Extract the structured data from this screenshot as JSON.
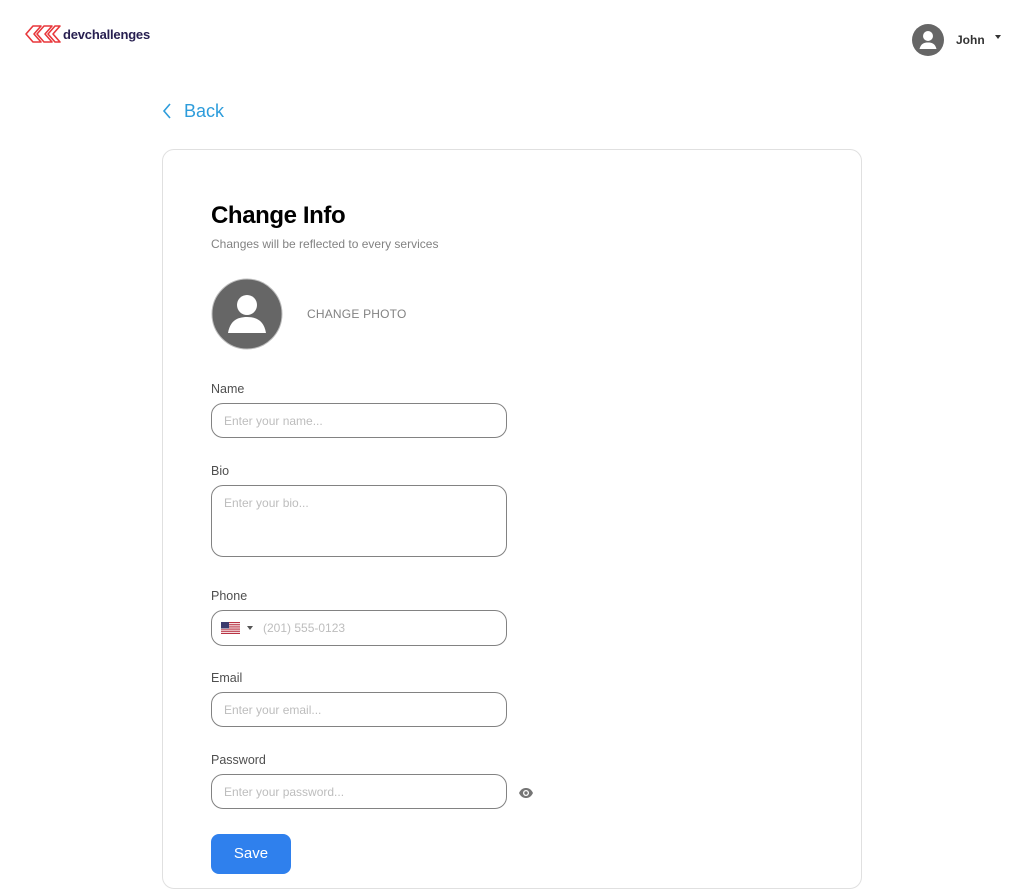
{
  "header": {
    "logo_text": "devchallenges",
    "user_name": "John",
    "brand_color": "#E8373B"
  },
  "nav": {
    "back_label": "Back"
  },
  "form": {
    "title": "Change Info",
    "subtitle": "Changes will be reflected to every services",
    "change_photo_label": "CHANGE PHOTO",
    "name": {
      "label": "Name",
      "placeholder": "Enter your name...",
      "value": ""
    },
    "bio": {
      "label": "Bio",
      "placeholder": "Enter your bio...",
      "value": ""
    },
    "phone": {
      "label": "Phone",
      "placeholder": "(201) 555-0123",
      "country": "US",
      "value": ""
    },
    "email": {
      "label": "Email",
      "placeholder": "Enter your email...",
      "value": ""
    },
    "password": {
      "label": "Password",
      "placeholder": "Enter your password...",
      "value": ""
    },
    "save_label": "Save"
  },
  "colors": {
    "accent": "#2F80ED",
    "link": "#2D9CDB",
    "avatar_gray": "#666666"
  },
  "icons": {
    "logo": "devchallenges-logo-icon",
    "user": "user-circle-icon",
    "back": "chevron-left-icon",
    "photo": "avatar-placeholder-icon",
    "flag": "us-flag-icon",
    "password_toggle": "eye-icon"
  }
}
